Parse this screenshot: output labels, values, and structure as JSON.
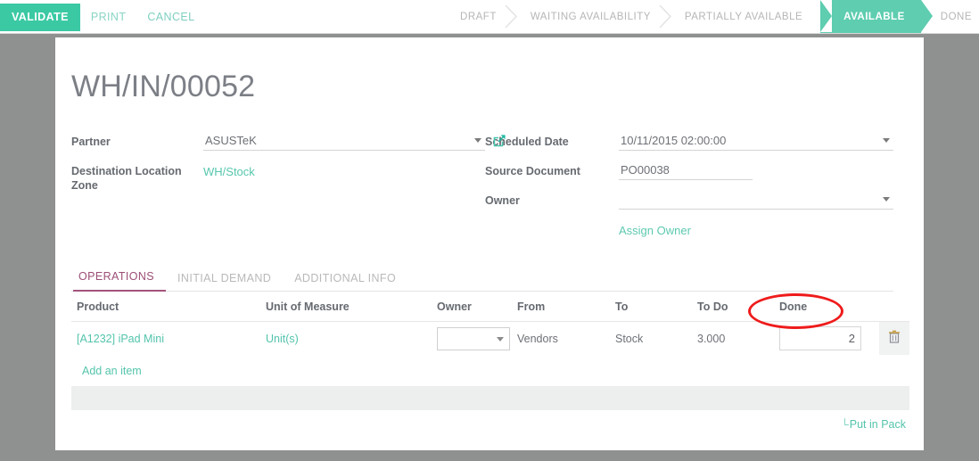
{
  "toolbar": {
    "validate_label": "VALIDATE",
    "print_label": "PRINT",
    "cancel_label": "CANCEL",
    "accent_color": "#3bc9a4"
  },
  "statusbar": {
    "active_color": "#5ecdb0",
    "stages": [
      {
        "label": "DRAFT",
        "active": false
      },
      {
        "label": "WAITING AVAILABILITY",
        "active": false
      },
      {
        "label": "PARTIALLY AVAILABLE",
        "active": false
      },
      {
        "label": "AVAILABLE",
        "active": true
      },
      {
        "label": "DONE",
        "active": false
      }
    ]
  },
  "document": {
    "title": "WH/IN/00052"
  },
  "form": {
    "left": {
      "partner_label": "Partner",
      "partner_value": "ASUSTeK",
      "destination_label": "Destination Location Zone",
      "destination_value": "WH/Stock"
    },
    "right": {
      "scheduled_date_label": "Scheduled Date",
      "scheduled_date_value": "10/11/2015 02:00:00",
      "source_document_label": "Source Document",
      "source_document_value": "PO00038",
      "owner_label": "Owner",
      "owner_value": "",
      "assign_owner_label": "Assign Owner"
    }
  },
  "tabs": [
    {
      "label": "OPERATIONS",
      "active": true
    },
    {
      "label": "INITIAL DEMAND",
      "active": false
    },
    {
      "label": "ADDITIONAL INFO",
      "active": false
    }
  ],
  "table": {
    "columns": [
      "Product",
      "Unit of Measure",
      "Owner",
      "From",
      "To",
      "To Do",
      "Done"
    ],
    "rows": [
      {
        "product": "[A1232] iPad Mini",
        "unit_of_measure": "Unit(s)",
        "owner": "",
        "from": "Vendors",
        "to": "Stock",
        "to_do": "3.000",
        "done": "2"
      }
    ],
    "add_item_label": "Add an item"
  },
  "footer": {
    "put_in_pack_label": "Put in Pack",
    "corner_glyph": "└"
  },
  "annotation": {
    "type": "red-ellipse",
    "color": "#ef1b1b",
    "targets": "done-quantity-input"
  }
}
